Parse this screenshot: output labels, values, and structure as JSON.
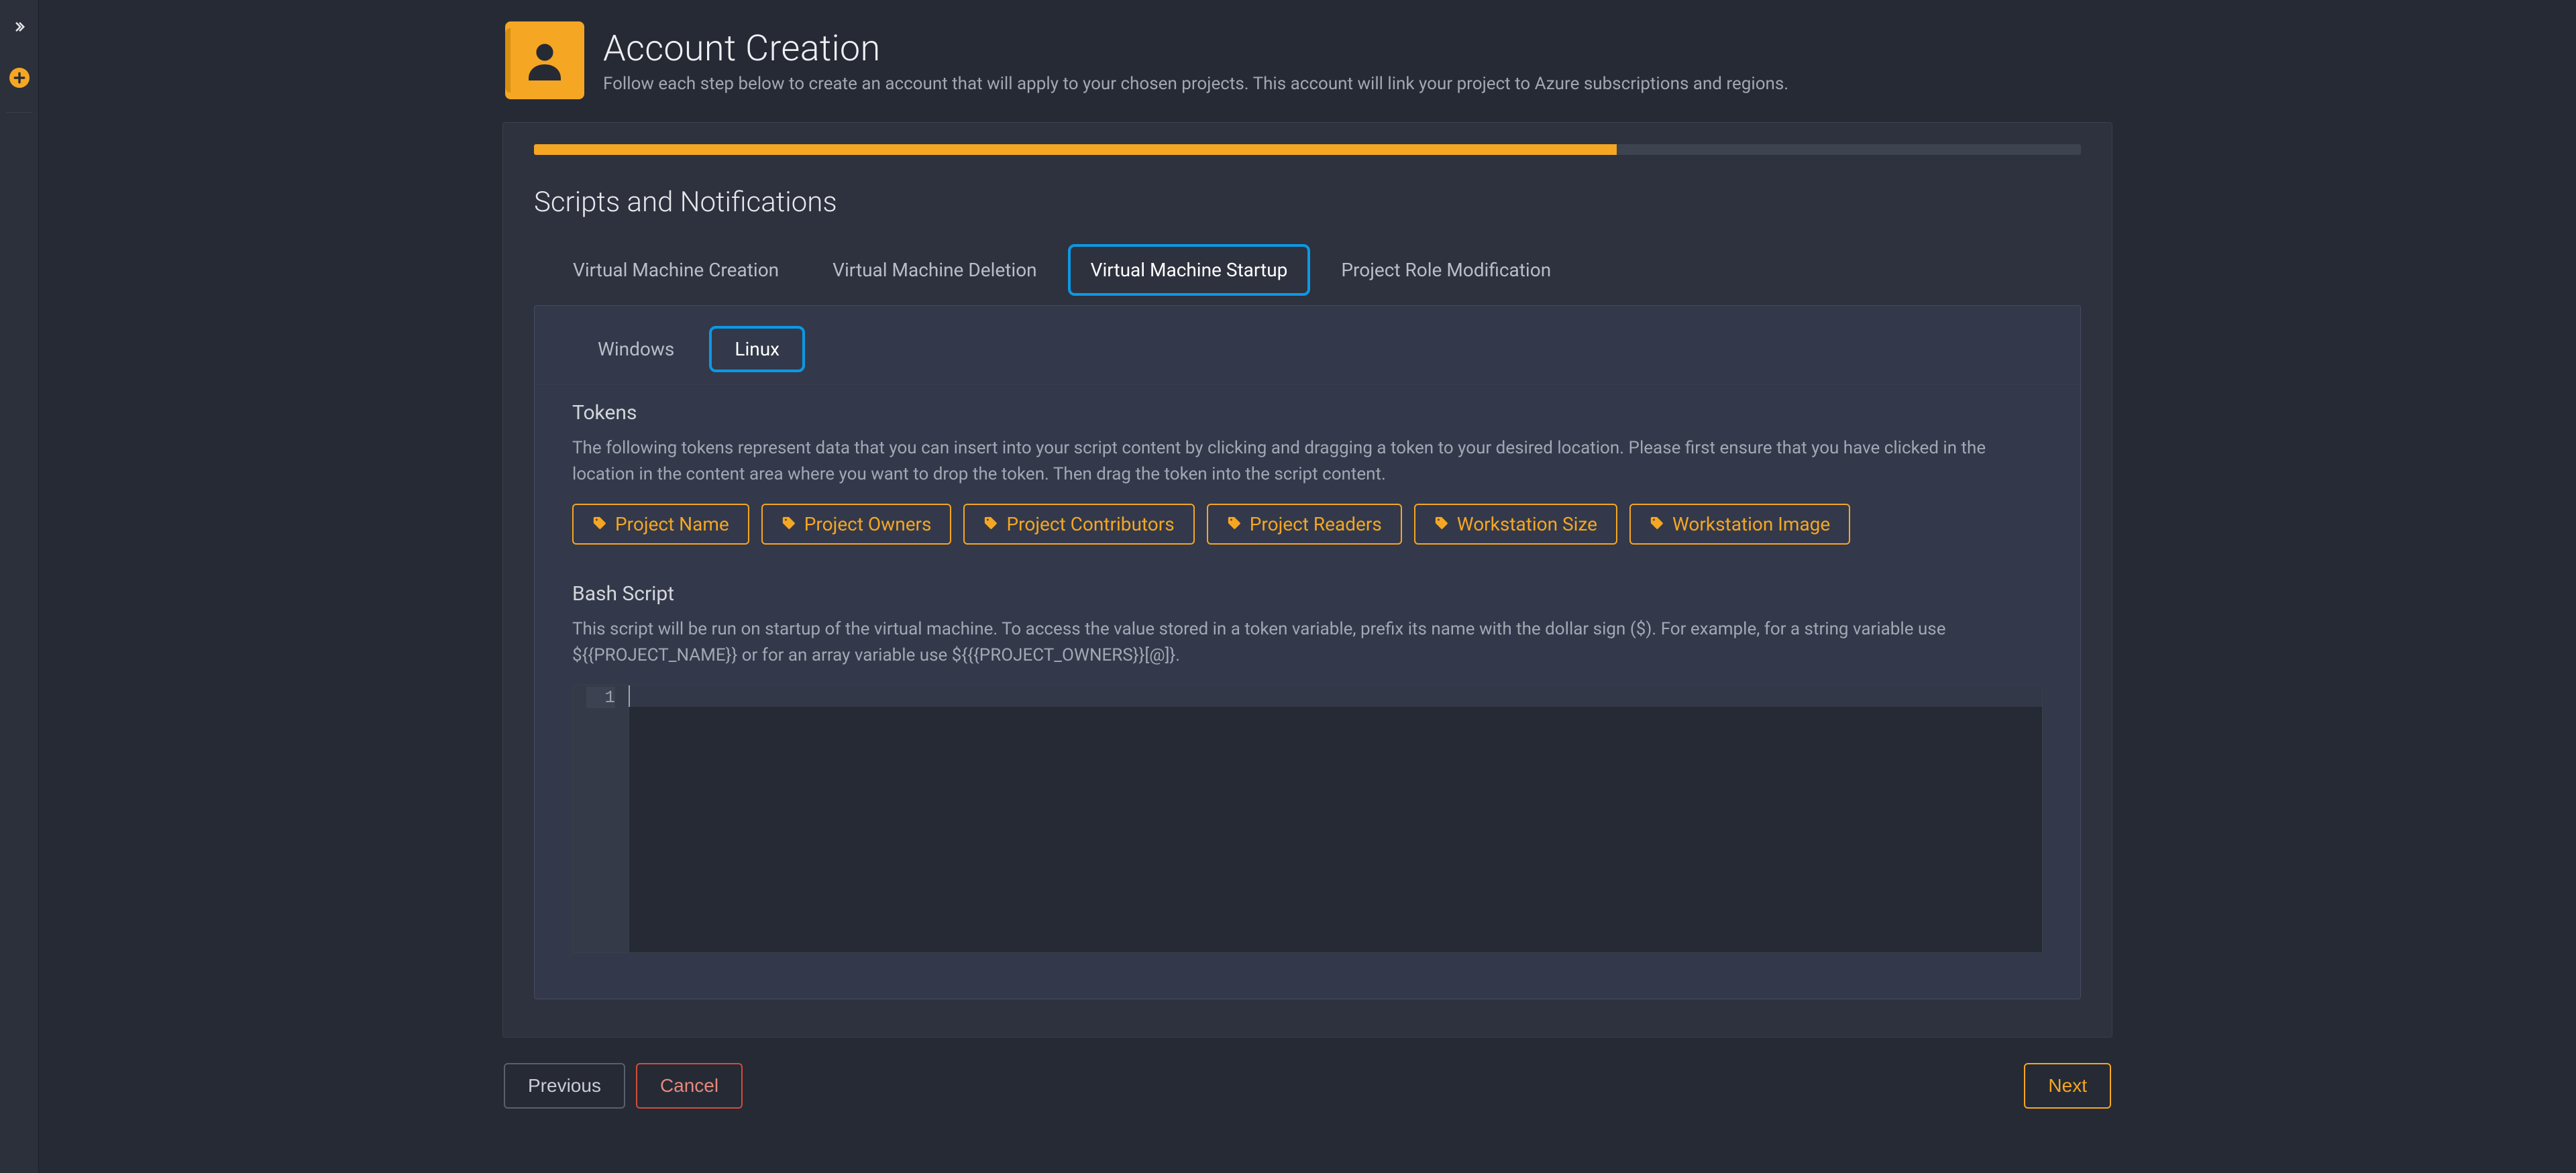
{
  "header": {
    "title": "Account Creation",
    "subtitle": "Follow each step below to create an account that will apply to your chosen projects. This account will link your project to Azure subscriptions and regions."
  },
  "progress": {
    "percent": 70
  },
  "section": {
    "title": "Scripts and Notifications"
  },
  "tabs": [
    {
      "label": "Virtual Machine Creation",
      "active": false
    },
    {
      "label": "Virtual Machine Deletion",
      "active": false
    },
    {
      "label": "Virtual Machine Startup",
      "active": true
    },
    {
      "label": "Project Role Modification",
      "active": false
    }
  ],
  "subtabs": [
    {
      "label": "Windows",
      "active": false
    },
    {
      "label": "Linux",
      "active": true
    }
  ],
  "tokens": {
    "heading": "Tokens",
    "desc": "The following tokens represent data that you can insert into your script content by clicking and dragging a token to your desired location. Please first ensure that you have clicked in the location in the content area where you want to drop the token. Then drag the token into the script content.",
    "items": [
      "Project Name",
      "Project Owners",
      "Project Contributors",
      "Project Readers",
      "Workstation Size",
      "Workstation Image"
    ]
  },
  "script": {
    "heading": "Bash Script",
    "desc": "This script will be run on startup of the virtual machine. To access the value stored in a token variable, prefix its name with the dollar sign ($). For example, for a string variable use ${{PROJECT_NAME}} or for an array variable use ${{{PROJECT_OWNERS}}[@]}.",
    "first_line_no": "1"
  },
  "footer": {
    "previous": "Previous",
    "cancel": "Cancel",
    "next": "Next"
  }
}
